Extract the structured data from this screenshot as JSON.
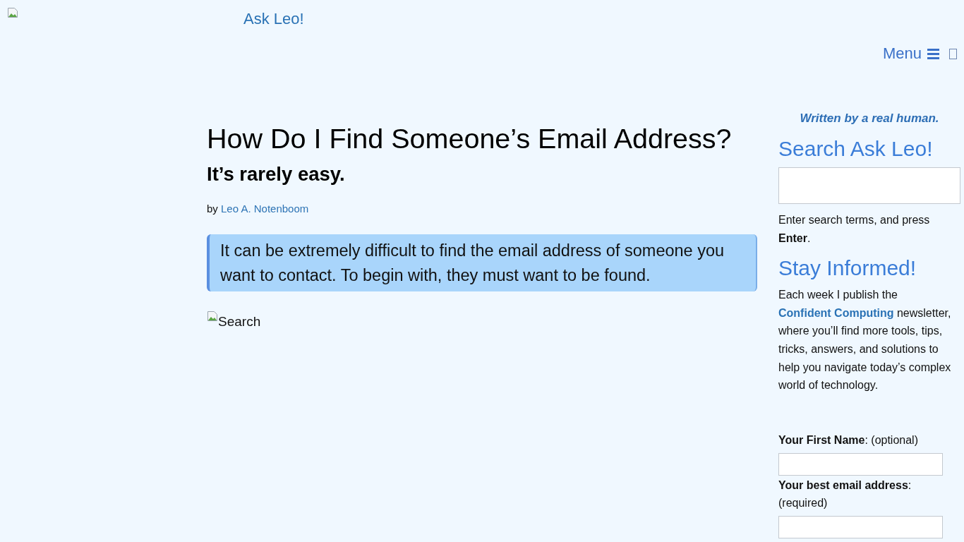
{
  "header": {
    "logo": "Ask Leo!",
    "menu": {
      "label": "Menu"
    }
  },
  "article": {
    "title": "How Do I Find Someone’s Email Address?",
    "subtitle": "It’s rarely easy.",
    "byline": {
      "prefix": "by",
      "author": "Leo A. Notenboom"
    },
    "summary": "It can be extremely difficult to find the email address of someone you want to contact. To begin with, they must want to be found.",
    "image_alt": "Search"
  },
  "sidebar": {
    "tagline": "Written by a real human.",
    "search": {
      "heading": "Search Ask Leo!",
      "hint": "Enter search terms, and press **Enter**."
    },
    "newsletter": {
      "heading": "Stay Informed!",
      "text_before": "Each week I publish the",
      "link": "Confident Computing",
      "text_after": "newsletter, where you’ll find more tools, tips, tricks, answers, and solutions to help you navigate today’s complex world of technology.",
      "fields": [
        {
          "label": "**Your First Name**: (optional)"
        },
        {
          "label": "**Your best email address**: (required)"
        }
      ]
    }
  }
}
